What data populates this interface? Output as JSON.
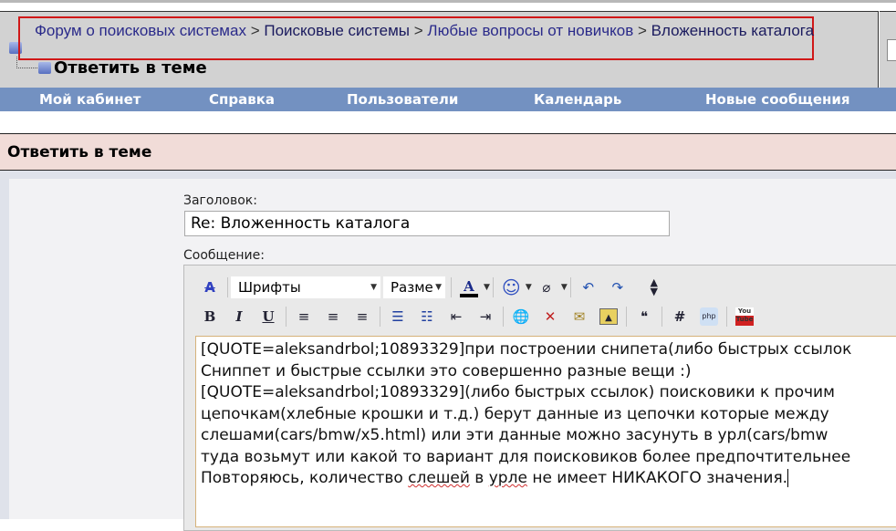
{
  "breadcrumb": {
    "items": [
      "Форум о поисковых системах",
      "Поисковые системы",
      "Любые вопросы от новичков",
      "Вложенность каталога"
    ],
    "separator": ">"
  },
  "header": {
    "title": "Ответить в теме"
  },
  "nav": [
    "Мой кабинет",
    "Справка",
    "Пользователи",
    "Календарь",
    "Новые сообщения"
  ],
  "section": {
    "title": "Ответить в теме"
  },
  "form": {
    "title_label": "Заголовок:",
    "title_value": "Re: Вложенность каталога",
    "message_label": "Сообщение:"
  },
  "toolbar": {
    "font_select": "Шрифты",
    "size_select": "Разме",
    "youtube_label": "You Tube"
  },
  "message": {
    "lines": [
      "[QUOTE=aleksandrbol;10893329]при построении снипета(либо быстрых ссылок",
      "Сниппет и быстрые ссылки это совершенно разные вещи :)",
      "[QUOTE=aleksandrbol;10893329](либо быстрых ссылок) поисковики к прочим",
      "цепочкам(хлебные крошки и т.д.) берут данные из цепочки которые между",
      "слешами(cars/bmw/x5.html) или эти данные можно засунуть в урл(cars/bmw",
      "туда возьмут или какой то вариант для поисковиков более предпочтительнее"
    ],
    "last_line": {
      "a": "Повторяюсь, количество ",
      "b": "слешей",
      "c": " в ",
      "d": "урле",
      "e": " не имеет НИКАКОГО значения."
    }
  }
}
